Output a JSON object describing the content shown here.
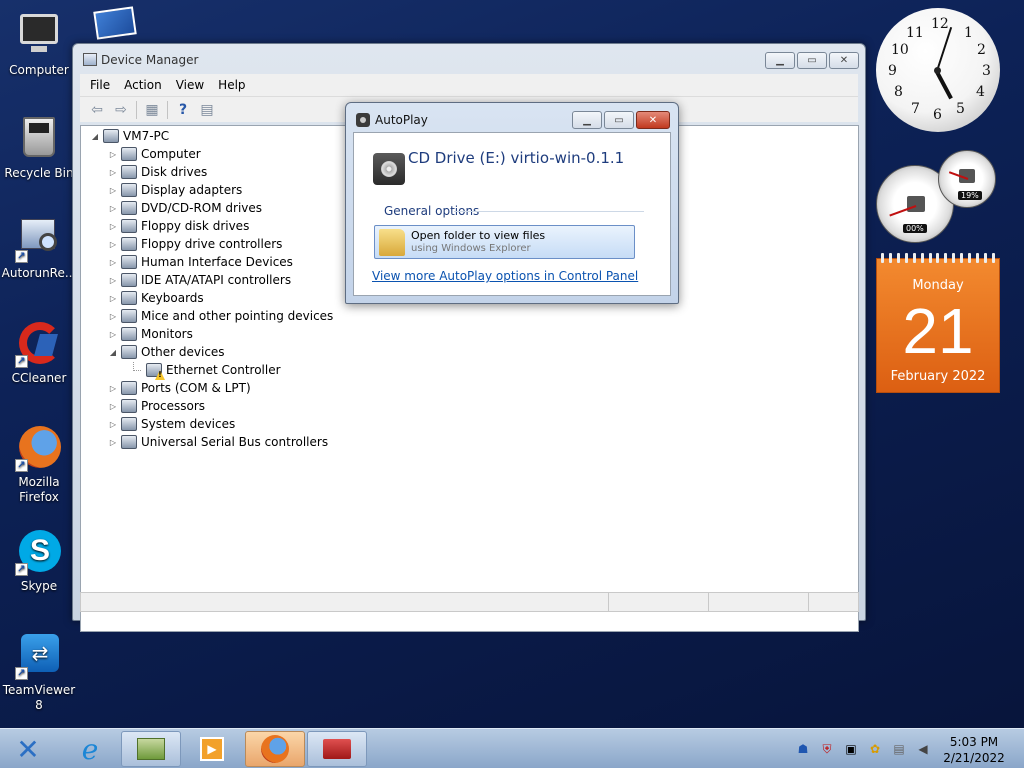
{
  "desktop": {
    "icons": [
      {
        "label": "Computer"
      },
      {
        "label": "Recycle Bin"
      },
      {
        "label": "AutorunRe..."
      },
      {
        "label": "CCleaner"
      },
      {
        "label": "Mozilla Firefox"
      },
      {
        "label": "Skype"
      },
      {
        "label": "TeamViewer 8"
      }
    ]
  },
  "device_manager": {
    "title": "Device Manager",
    "menu": [
      "File",
      "Action",
      "View",
      "Help"
    ],
    "tree": {
      "root": "VM7-PC",
      "items": [
        {
          "label": "Computer",
          "icon": "computer-icon"
        },
        {
          "label": "Disk drives",
          "icon": "disk-drive-icon"
        },
        {
          "label": "Display adapters",
          "icon": "display-adapter-icon"
        },
        {
          "label": "DVD/CD-ROM drives",
          "icon": "dvd-drive-icon"
        },
        {
          "label": "Floppy disk drives",
          "icon": "floppy-disk-icon"
        },
        {
          "label": "Floppy drive controllers",
          "icon": "floppy-controller-icon"
        },
        {
          "label": "Human Interface Devices",
          "icon": "hid-icon"
        },
        {
          "label": "IDE ATA/ATAPI controllers",
          "icon": "ide-controller-icon"
        },
        {
          "label": "Keyboards",
          "icon": "keyboard-icon"
        },
        {
          "label": "Mice and other pointing devices",
          "icon": "mouse-icon"
        },
        {
          "label": "Monitors",
          "icon": "monitor-icon"
        },
        {
          "label": "Other devices",
          "icon": "unknown-device-icon",
          "expanded": true
        },
        {
          "label": "Ethernet Controller",
          "icon": "warning-device-icon",
          "child": true
        },
        {
          "label": "Ports (COM & LPT)",
          "icon": "port-icon"
        },
        {
          "label": "Processors",
          "icon": "processor-icon"
        },
        {
          "label": "System devices",
          "icon": "system-device-icon"
        },
        {
          "label": "Universal Serial Bus controllers",
          "icon": "usb-icon"
        }
      ]
    }
  },
  "autoplay": {
    "title": "AutoPlay",
    "drive_label": "CD Drive (E:) virtio-win-0.1.1",
    "section_label": "General options",
    "option_main": "Open folder to view files",
    "option_sub": "using Windows Explorer",
    "link": "View more AutoPlay options in Control Panel"
  },
  "gadgets": {
    "clock_numbers": [
      "12",
      "1",
      "2",
      "3",
      "4",
      "5",
      "6",
      "7",
      "8",
      "9",
      "10",
      "11"
    ],
    "clock_time": "5:03",
    "cpu_meter": "00%",
    "mem_meter": "19%",
    "calendar": {
      "weekday": "Monday",
      "day": "21",
      "month_year": "February 2022"
    }
  },
  "taskbar": {
    "time": "5:03 PM",
    "date": "2/21/2022"
  },
  "colors": {
    "accent": "#1e3c7d",
    "link": "#0b53b0",
    "calendar": "#e8701f"
  }
}
